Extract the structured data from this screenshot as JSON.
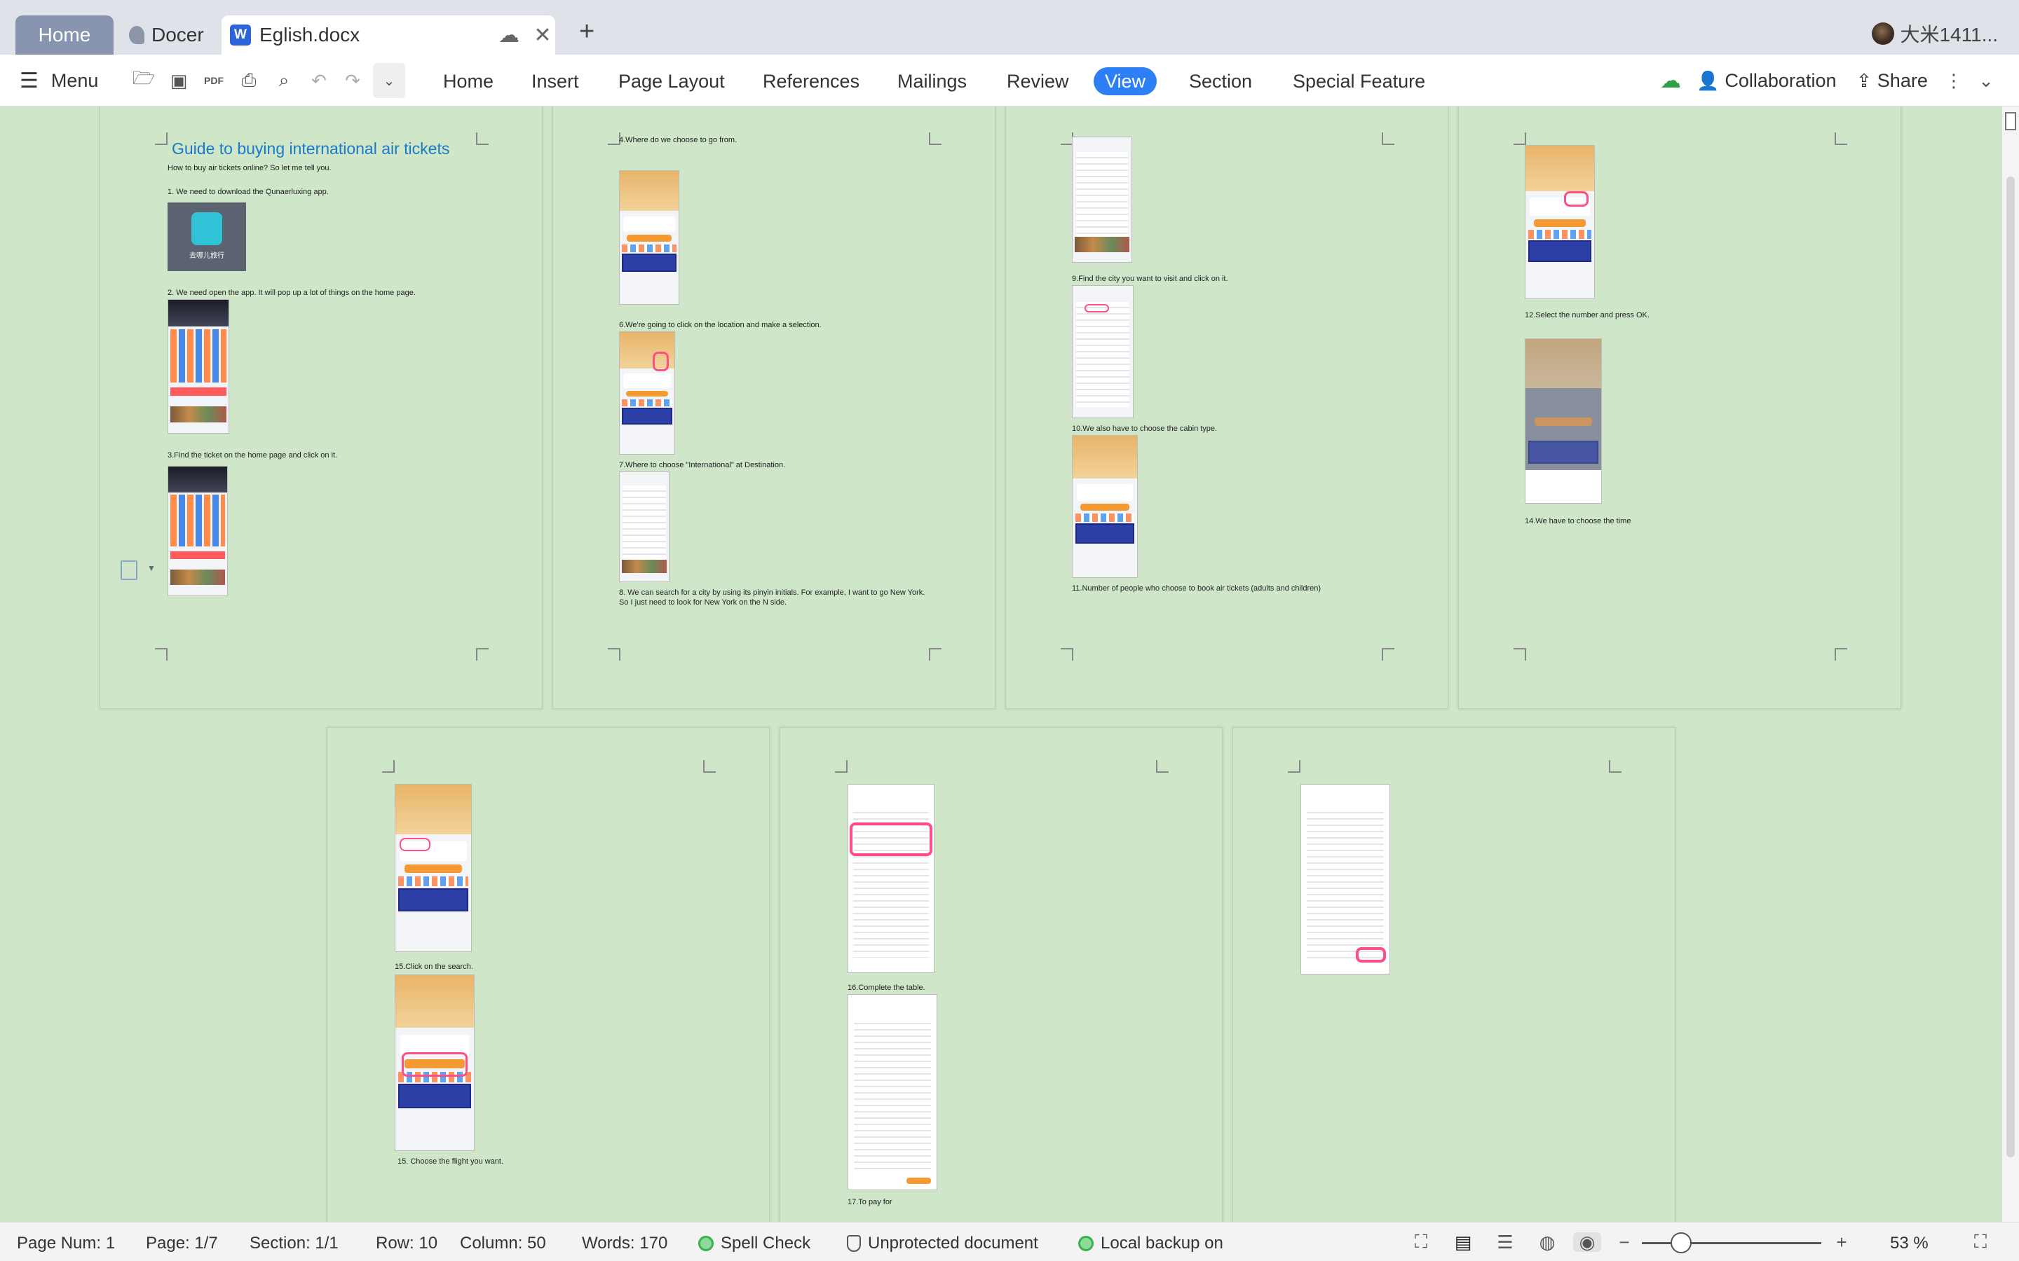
{
  "tabs": {
    "home": "Home",
    "docer": "Docer",
    "document": "Eglish.docx",
    "new_tab": "+",
    "user": "大米1411..."
  },
  "ribbon": {
    "menu": "Menu",
    "tabs": [
      "Home",
      "Insert",
      "Page Layout",
      "References",
      "Mailings",
      "Review",
      "View",
      "Section",
      "Special Feature"
    ],
    "active_tab": "View",
    "collaboration": "Collaboration",
    "share": "Share"
  },
  "document": {
    "title": "Guide to buying international air tickets",
    "intro": "How to buy air tickets online? So let me tell you.",
    "step1": "1.  We need to download the Qunaerluxing app.",
    "app_caption": "去哪儿旅行",
    "step2": "2.  We need open the app.   It will pop up a lot of things on the home page.",
    "step3": "3.Find the ticket on the home page and click on it.",
    "step4": "4.Where do we choose to go from.",
    "step6": "6.We're going to click on the location and make a selection.",
    "step7": "7.Where to choose \"International\" at Destination.",
    "step8a": "8.  We can search for a city by using its pinyin initials. For example,  I want to  go New York.",
    "step8b": "So I just need to look for New York on the N side.",
    "step9": "9.Find the city you want to visit and click on it.",
    "step10": "10.We also have to choose the cabin type.",
    "step11": "11.Number of people who choose to book air tickets (adults and children)",
    "step12": "12.Select the number and press OK.",
    "step14": "14.We have to choose the time",
    "step15a": "15.Click on the search.",
    "step15b": "15. Choose the flight you want.",
    "step16": "16.Complete the table.",
    "step17": "17.To pay for"
  },
  "status": {
    "page_num": "Page Num: 1",
    "page": "Page: 1/7",
    "section": "Section: 1/1",
    "row": "Row: 10",
    "column": "Column: 50",
    "words": "Words: 170",
    "spell_check": "Spell Check",
    "protection": "Unprotected document",
    "backup": "Local backup on",
    "zoom": "53 %",
    "zoom_fraction": 0.22
  },
  "icons": [
    "menu-icon",
    "open-icon",
    "save-icon",
    "pdf-icon",
    "print-icon",
    "print-preview-icon",
    "undo-icon",
    "redo-icon",
    "more-icon",
    "cloud-sync-icon",
    "collaboration-icon",
    "share-icon",
    "more-vertical-icon",
    "collapse-icon",
    "fullscreen-icon",
    "page-view-icon",
    "outline-view-icon",
    "web-view-icon",
    "eye-protection-icon",
    "zoom-out-icon",
    "zoom-in-icon",
    "fit-page-icon"
  ]
}
